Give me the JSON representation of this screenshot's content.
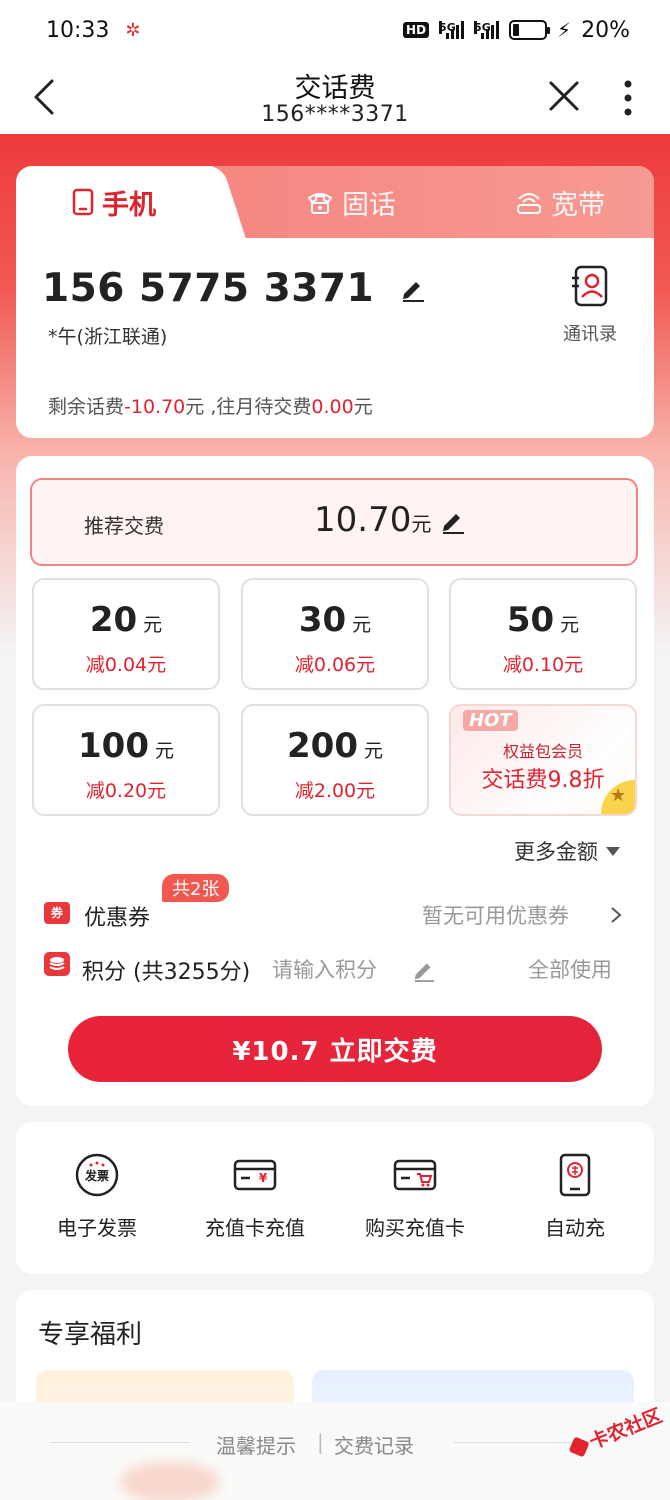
{
  "status_bar": {
    "time": "10:33",
    "battery": "20%",
    "network": "5G"
  },
  "nav": {
    "title": "交话费",
    "subtitle": "156****3371"
  },
  "tabs": [
    {
      "label": "手机",
      "icon": "mobile-phone-icon",
      "active": true
    },
    {
      "label": "固话",
      "icon": "landline-phone-icon",
      "active": false
    },
    {
      "label": "宽带",
      "icon": "broadband-icon",
      "active": false
    }
  ],
  "account": {
    "phone_number": "156 5775 3371",
    "owner": "*午(浙江联通)",
    "contacts_label": "通讯录",
    "balance_prefix": "剩余话费",
    "balance_value": "-10.70",
    "balance_unit": "元",
    "pending_prefix": " ,往月待交费",
    "pending_value": "0.00",
    "pending_unit": "元"
  },
  "recommend": {
    "label": "推荐交费",
    "amount": "10.70",
    "unit": "元"
  },
  "amounts": [
    {
      "value": "20",
      "unit": "元",
      "discount": "减0.04元"
    },
    {
      "value": "30",
      "unit": "元",
      "discount": "减0.06元"
    },
    {
      "value": "50",
      "unit": "元",
      "discount": "减0.10元"
    },
    {
      "value": "100",
      "unit": "元",
      "discount": "减0.20元"
    },
    {
      "value": "200",
      "unit": "元",
      "discount": "减2.00元"
    }
  ],
  "promo": {
    "badge": "HOT",
    "line1": "权益包会员",
    "line2": "交话费9.8折"
  },
  "more_amount": "更多金额",
  "coupon": {
    "icon_text": "券",
    "label": "优惠券",
    "badge": "共2张",
    "status": "暂无可用优惠券"
  },
  "points": {
    "label": "积分 (共3255分)",
    "placeholder": "请输入积分",
    "use_all": "全部使用"
  },
  "pay_button": "¥10.7 立即交费",
  "tools": [
    {
      "label": "电子发票",
      "icon": "invoice-icon",
      "icon_text": "发票"
    },
    {
      "label": "充值卡充值",
      "icon": "recharge-card-icon",
      "icon_text": "¥"
    },
    {
      "label": "购买充值卡",
      "icon": "buy-card-icon"
    },
    {
      "label": "自动充",
      "icon": "auto-recharge-icon"
    }
  ],
  "perks": {
    "title": "专享福利"
  },
  "footer": {
    "tips": "温馨提示",
    "separator": "|",
    "record": "交费记录"
  },
  "watermark": "卡农社区",
  "colors": {
    "brand_red": "#e0242f",
    "hero_top": "#ee3a3d",
    "button_red": "#e8233a"
  }
}
